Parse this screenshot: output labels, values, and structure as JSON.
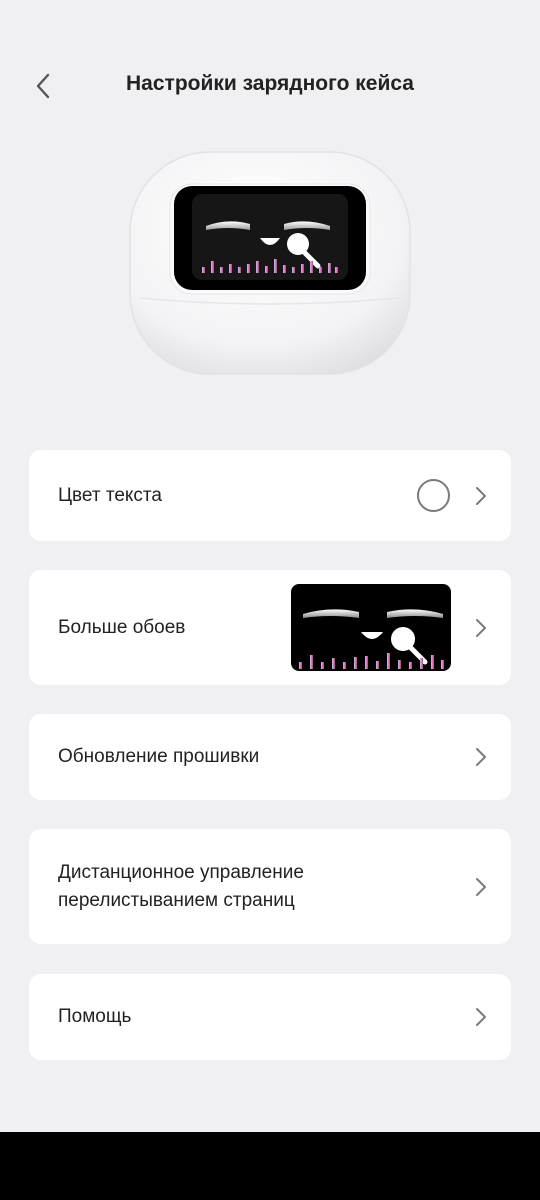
{
  "header": {
    "title": "Настройки зарядного кейса",
    "back_icon": "chevron-left-icon"
  },
  "device": {
    "image": "charging-case-with-face-display"
  },
  "settings": {
    "text_color": {
      "label": "Цвет текста",
      "swatch_color": "#ffffff",
      "swatch_border": "#7a7a7a"
    },
    "wallpapers": {
      "label": "Больше обоев"
    },
    "firmware": {
      "label": "Обновление прошивки"
    },
    "page_turn": {
      "label": "Дистанционное управление перелистыванием страниц"
    },
    "help": {
      "label": "Помощь"
    }
  },
  "colors": {
    "background": "#f0f0f3",
    "card": "#ffffff",
    "text": "#222222",
    "chevron": "#7a7a7a",
    "screen": "#000000",
    "bars_gradient": [
      "#a8c4f0",
      "#c090d0",
      "#e0508a",
      "#f0205a"
    ]
  }
}
